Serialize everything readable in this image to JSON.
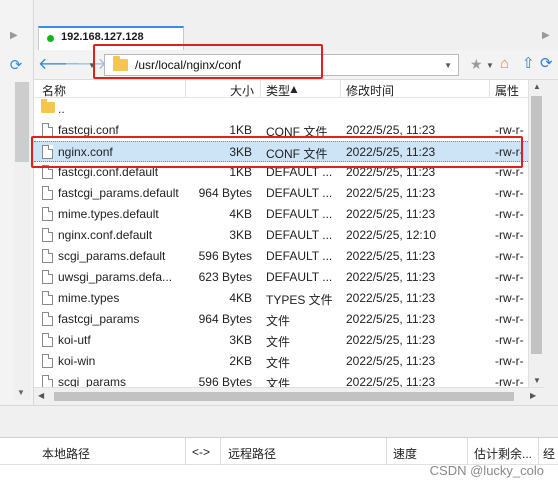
{
  "tab": {
    "title": "192.168.127.128"
  },
  "toolbar": {
    "path": "/usr/local/nginx/conf"
  },
  "columns": {
    "name": "名称",
    "size": "大小",
    "type": "类型",
    "mtime": "修改时间",
    "attr": "属性"
  },
  "parent": {
    "label": ".."
  },
  "files": [
    {
      "name": "fastcgi.conf",
      "size": "1KB",
      "type": "CONF 文件",
      "mtime": "2022/5/25, 11:23",
      "attr": "-rw-r-"
    },
    {
      "name": "nginx.conf",
      "size": "3KB",
      "type": "CONF 文件",
      "mtime": "2022/5/25, 11:23",
      "attr": "-rw-r-",
      "selected": true
    },
    {
      "name": "fastcgi.conf.default",
      "size": "1KB",
      "type": "DEFAULT ...",
      "mtime": "2022/5/25, 11:23",
      "attr": "-rw-r-"
    },
    {
      "name": "fastcgi_params.default",
      "size": "964 Bytes",
      "type": "DEFAULT ...",
      "mtime": "2022/5/25, 11:23",
      "attr": "-rw-r-"
    },
    {
      "name": "mime.types.default",
      "size": "4KB",
      "type": "DEFAULT ...",
      "mtime": "2022/5/25, 11:23",
      "attr": "-rw-r-"
    },
    {
      "name": "nginx.conf.default",
      "size": "3KB",
      "type": "DEFAULT ...",
      "mtime": "2022/5/25, 12:10",
      "attr": "-rw-r-"
    },
    {
      "name": "scgi_params.default",
      "size": "596 Bytes",
      "type": "DEFAULT ...",
      "mtime": "2022/5/25, 11:23",
      "attr": "-rw-r-"
    },
    {
      "name": "uwsgi_params.defa...",
      "size": "623 Bytes",
      "type": "DEFAULT ...",
      "mtime": "2022/5/25, 11:23",
      "attr": "-rw-r-"
    },
    {
      "name": "mime.types",
      "size": "4KB",
      "type": "TYPES 文件",
      "mtime": "2022/5/25, 11:23",
      "attr": "-rw-r-"
    },
    {
      "name": "fastcgi_params",
      "size": "964 Bytes",
      "type": "文件",
      "mtime": "2022/5/25, 11:23",
      "attr": "-rw-r-"
    },
    {
      "name": "koi-utf",
      "size": "3KB",
      "type": "文件",
      "mtime": "2022/5/25, 11:23",
      "attr": "-rw-r-"
    },
    {
      "name": "koi-win",
      "size": "2KB",
      "type": "文件",
      "mtime": "2022/5/25, 11:23",
      "attr": "-rw-r-"
    },
    {
      "name": "scgi_params",
      "size": "596 Bytes",
      "type": "文件",
      "mtime": "2022/5/25, 11:23",
      "attr": "-rw-r-"
    }
  ],
  "queue": {
    "local": "本地路径",
    "dir": "<->",
    "remote": "远程路径",
    "speed": "速度",
    "remaining": "估计剩余...",
    "extra": "经"
  },
  "watermark": "CSDN @lucky_colo",
  "colors": {
    "accent": "#3c8dde",
    "highlight": "#e0201e",
    "selection": "#cde4f7",
    "connected": "#11b522"
  }
}
